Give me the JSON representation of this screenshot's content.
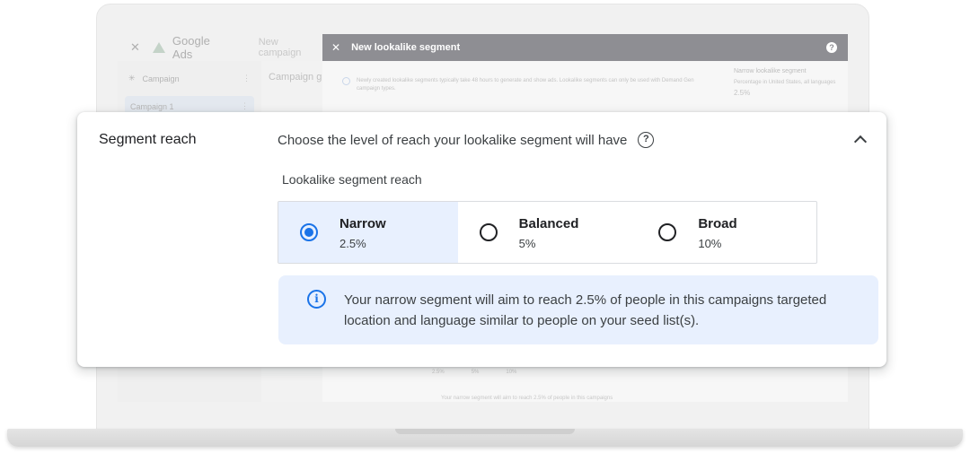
{
  "background_app": {
    "product_name": "Google Ads",
    "new_campaign": "New campaign",
    "dialog_title": "New lookalike segment",
    "sidebar": [
      {
        "label": "Campaign"
      },
      {
        "label": "Campaign 1"
      }
    ],
    "mid_title": "Campaign gr",
    "note": "Newly created lookalike segments typically take 48 hours to generate and show ads. Lookalike segments can only be used with Demand Gen campaign types.",
    "side_panel": {
      "title": "Narrow lookalike segment",
      "desc": "Percentage in United States, all languages",
      "value": "2.5%"
    },
    "ghost_options": [
      "2.5%",
      "5%",
      "10%"
    ],
    "ghost_note": "Your narrow segment will aim to reach 2.5% of people in this campaigns"
  },
  "card": {
    "title": "Segment reach",
    "question": "Choose the level of reach your lookalike segment will have",
    "reach_label": "Lookalike segment reach",
    "options": [
      {
        "name": "Narrow",
        "percent": "2.5%",
        "selected": true
      },
      {
        "name": "Balanced",
        "percent": "5%",
        "selected": false
      },
      {
        "name": "Broad",
        "percent": "10%",
        "selected": false
      }
    ],
    "info_text": "Your narrow segment will aim to reach 2.5% of people in this campaigns targeted location and language similar to people on your seed list(s)."
  },
  "colors": {
    "accent": "#1a73e8",
    "selected_bg": "#e8f0fe",
    "dialog_header": "#8e8e93"
  },
  "icons": [
    "close-icon",
    "google-ads-logo-icon",
    "help-icon",
    "chevron-up-icon",
    "radio-icon",
    "info-icon"
  ]
}
